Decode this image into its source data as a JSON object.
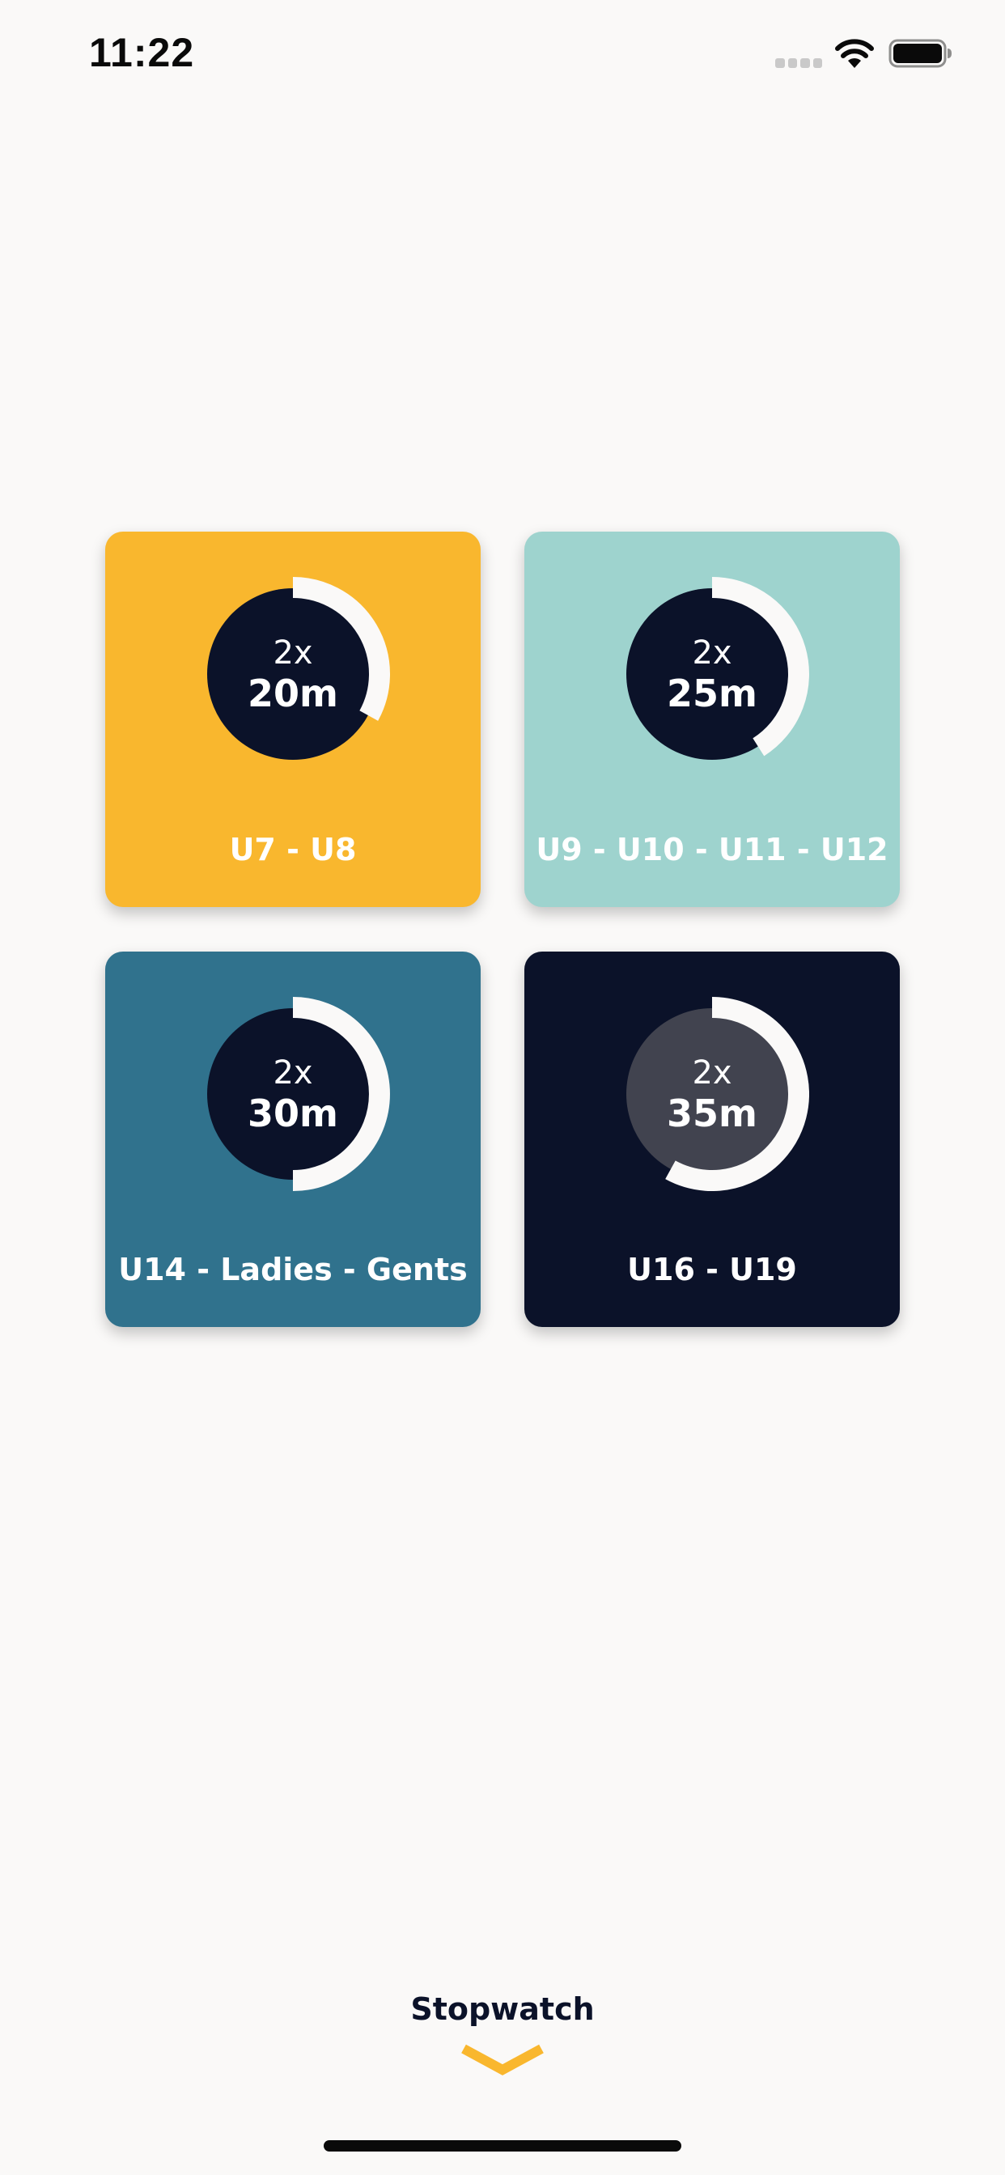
{
  "status_bar": {
    "time": "11:22"
  },
  "colors": {
    "background": "#faf9f8",
    "navy": "#0b1229",
    "accent": "#f9b72e"
  },
  "cards": [
    {
      "label": "U7 - U8",
      "count": "2x",
      "duration": "20m",
      "color": "#f9b72e",
      "progress_fraction": 0.33,
      "selected": false
    },
    {
      "label": "U9 - U10 - U11 - U12",
      "count": "2x",
      "duration": "25m",
      "color": "#9ed3ce",
      "progress_fraction": 0.41,
      "selected": false
    },
    {
      "label": "U14 - Ladies - Gents",
      "count": "2x",
      "duration": "30m",
      "color": "#30728d",
      "progress_fraction": 0.5,
      "selected": false
    },
    {
      "label": "U16 - U19",
      "count": "2x",
      "duration": "35m",
      "color": "#0b1229",
      "progress_fraction": 0.58,
      "selected": true
    }
  ],
  "stopwatch": {
    "label": "Stopwatch",
    "icon": "chevron-down-icon"
  }
}
